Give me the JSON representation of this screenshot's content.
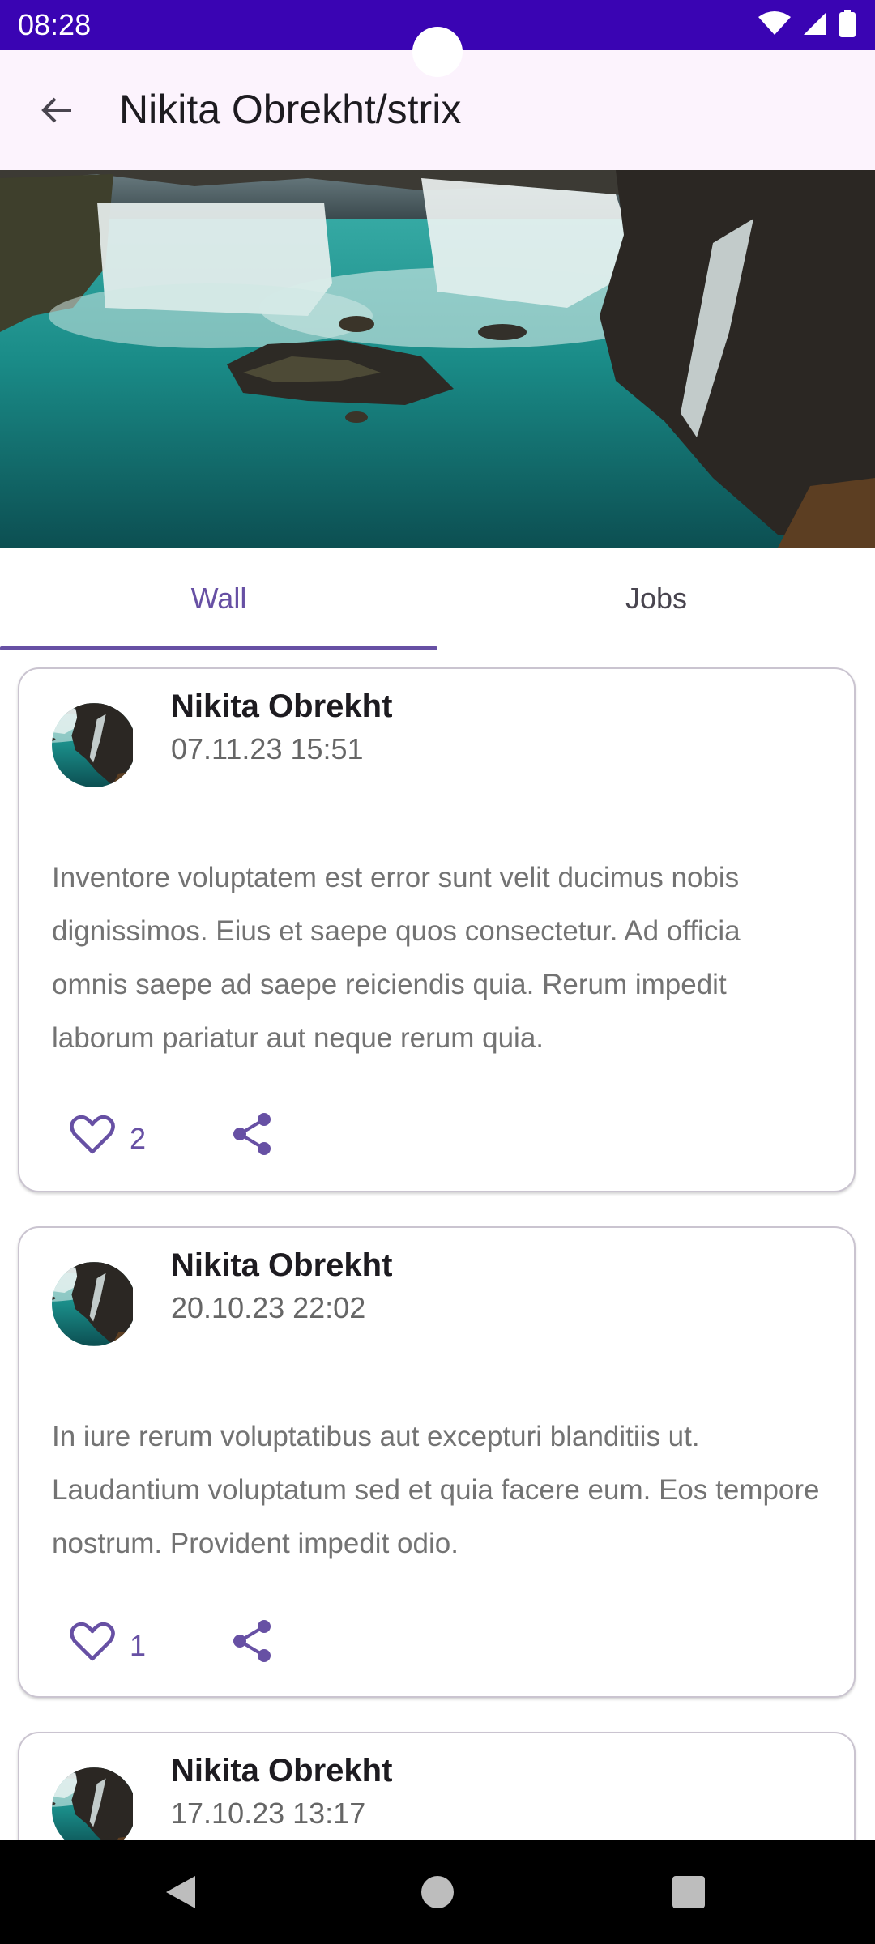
{
  "status_bar": {
    "time": "08:28"
  },
  "app_bar": {
    "title": "Nikita Obrekht/strix"
  },
  "tabs": [
    {
      "label": "Wall",
      "selected": true
    },
    {
      "label": "Jobs",
      "selected": false
    }
  ],
  "posts": [
    {
      "author": "Nikita Obrekht",
      "date": "07.11.23 15:51",
      "content": "Inventore voluptatem est error sunt velit ducimus nobis dignissimos. Eius et saepe quos consectetur. Ad officia omnis saepe ad saepe reiciendis quia. Rerum impedit laborum pariatur aut neque rerum quia.",
      "likes": "2"
    },
    {
      "author": "Nikita Obrekht",
      "date": "20.10.23 22:02",
      "content": "In iure rerum voluptatibus aut excepturi blanditiis ut. Laudantium voluptatum sed et quia facere eum. Eos tempore nostrum. Provident impedit odio.",
      "likes": "1"
    },
    {
      "author": "Nikita Obrekht",
      "date": "17.10.23 13:17"
    }
  ],
  "icons": {
    "back": "arrow-back-icon",
    "like": "heart-outline-icon",
    "share": "share-icon",
    "nav_back": "triangle-back-icon",
    "nav_home": "circle-home-icon",
    "nav_recents": "square-recents-icon"
  },
  "colors": {
    "status_bar": "#3a04b3",
    "app_bar": "#fcf3fd",
    "accent": "#6750a4",
    "card_border": "#cac4d0"
  }
}
